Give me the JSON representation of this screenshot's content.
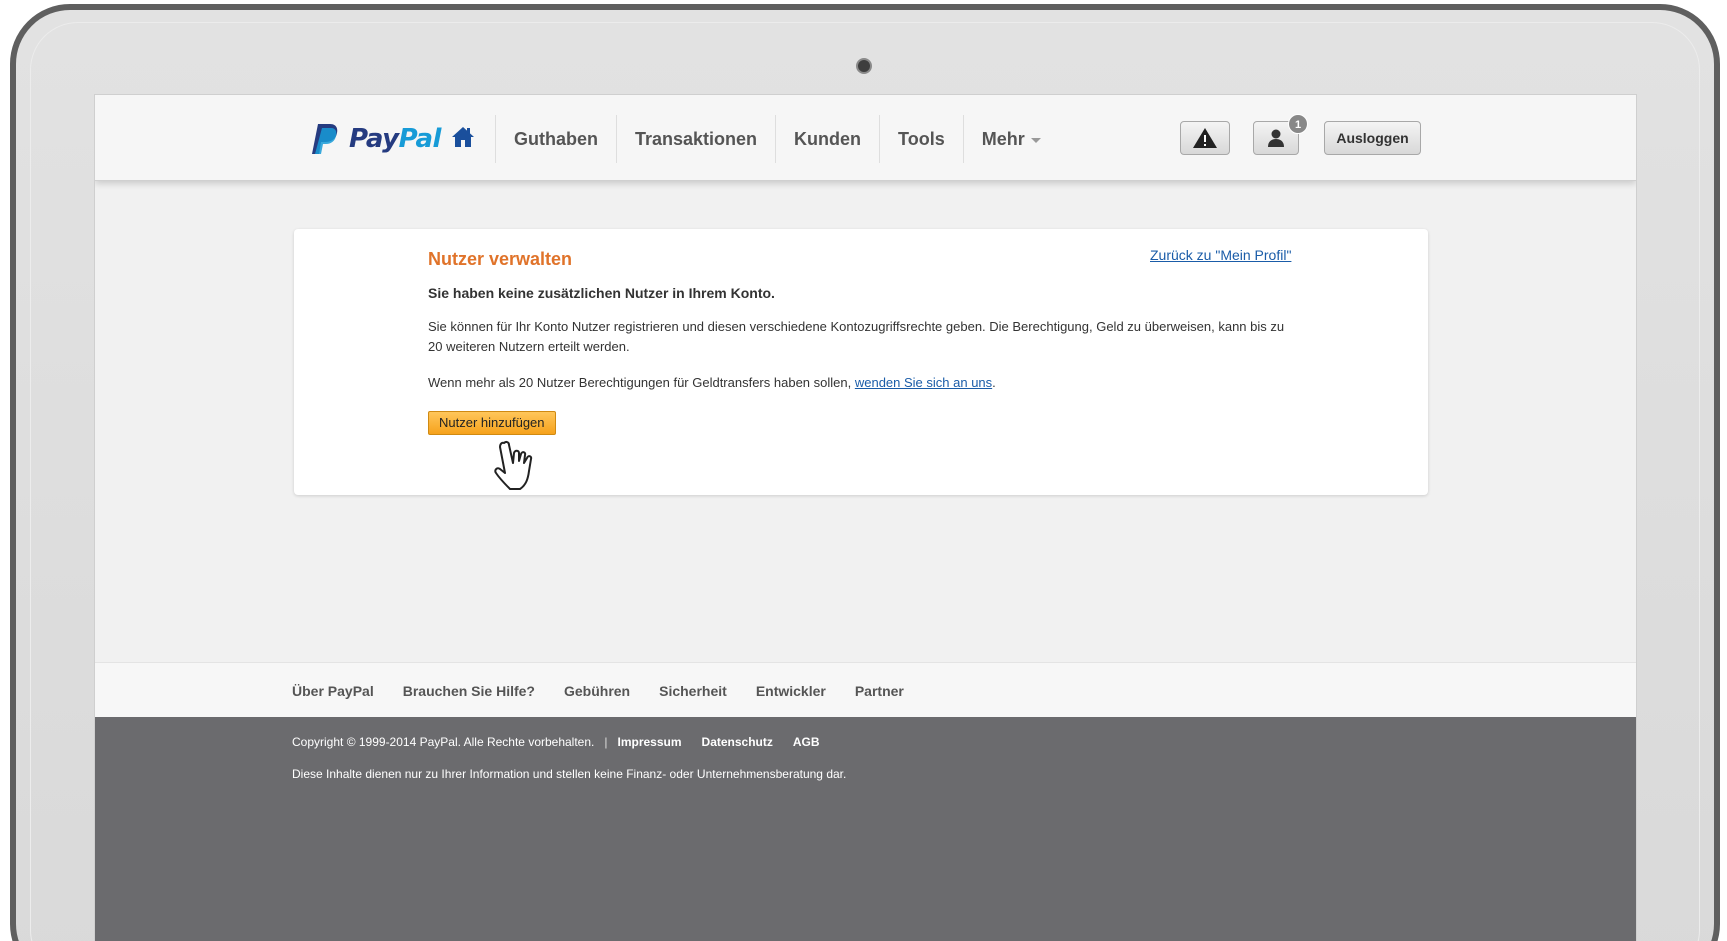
{
  "brand": {
    "pay": "Pay",
    "pal": "Pal"
  },
  "nav": {
    "items": [
      {
        "label": "Guthaben"
      },
      {
        "label": "Transaktionen"
      },
      {
        "label": "Kunden"
      },
      {
        "label": "Tools"
      },
      {
        "label": "Mehr"
      }
    ],
    "notification_count": "1",
    "logout_label": "Ausloggen"
  },
  "card": {
    "title": "Nutzer verwalten",
    "back_link": "Zurück zu \"Mein Profil\"",
    "subtitle": "Sie haben keine zusätzlichen Nutzer in Ihrem Konto.",
    "description": "Sie können für Ihr Konto Nutzer registrieren und diesen verschiedene Kontozugriffsrechte geben. Die Berechtigung, Geld zu überweisen, kann bis zu 20 weiteren Nutzern erteilt werden.",
    "note_text": "Wenn mehr als 20 Nutzer Berechtigungen für Geldtransfers haben sollen, ",
    "note_link": "wenden Sie sich an uns",
    "note_end": ".",
    "add_button": "Nutzer hinzufügen"
  },
  "footer": {
    "links": [
      {
        "label": "Über PayPal"
      },
      {
        "label": "Brauchen Sie Hilfe?"
      },
      {
        "label": "Gebühren"
      },
      {
        "label": "Sicherheit"
      },
      {
        "label": "Entwickler"
      },
      {
        "label": "Partner"
      }
    ],
    "copyright": "Copyright © 1999-2014 PayPal. Alle Rechte vorbehalten.",
    "separator": "|",
    "legal_links": [
      {
        "label": "Impressum"
      },
      {
        "label": "Datenschutz"
      },
      {
        "label": "AGB"
      }
    ],
    "disclaimer": "Diese Inhalte dienen nur zu Ihrer Information und stellen keine Finanz- oder Unternehmensberatung dar."
  },
  "colors": {
    "brand_dark": "#253b80",
    "brand_light": "#179bd7",
    "title_orange": "#e0732a",
    "button_orange": "#f6a21c",
    "link_blue": "#1a5ca8",
    "footer_dark": "#6b6b6e"
  },
  "icons": {
    "home": "home-icon",
    "alert": "warning-icon",
    "user": "user-icon",
    "cursor": "hand-cursor-icon"
  }
}
